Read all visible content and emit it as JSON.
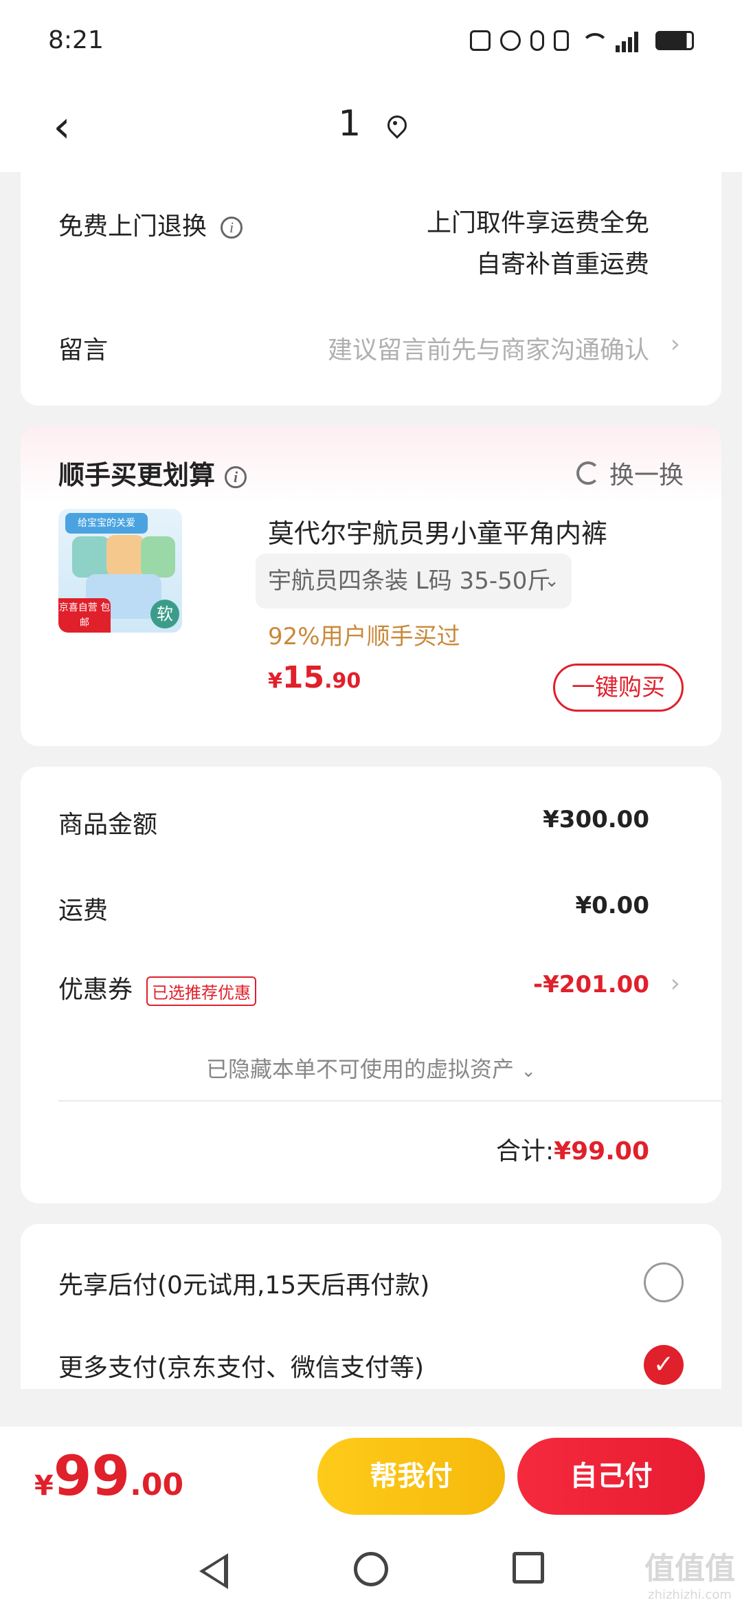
{
  "status_bar": {
    "time": "8:21"
  },
  "nav": {
    "title": "1"
  },
  "returns": {
    "label": "免费上门退换",
    "line1": "上门取件享运费全免",
    "line2": "自寄补首重运费"
  },
  "message": {
    "label": "留言",
    "placeholder": "建议留言前先与商家沟通确认"
  },
  "recommend": {
    "title": "顺手买更划算",
    "swap_label": "换一换",
    "thumb_banner": "给宝宝的关爱",
    "thumb_badge": "京喜自营 包邮",
    "thumb_soft": "软",
    "product_name": "莫代尔宇航员男小童平角内裤",
    "spec": "宇航员四条装   L码 35-50斤",
    "buyers": "92%用户顺手买过",
    "price_yen": "¥",
    "price_int": "15",
    "price_dec": ".90",
    "buy_label": "一键购买"
  },
  "summary": {
    "goods_label": "商品金额",
    "goods_value": "¥300.00",
    "shipping_label": "运费",
    "shipping_value": "¥0.00",
    "coupon_label": "优惠券",
    "coupon_tag": "已选推荐优惠",
    "coupon_value": "-¥201.00",
    "hidden_assets": "已隐藏本单不可使用的虚拟资产",
    "total_label": "合计:",
    "total_value": "¥99.00"
  },
  "payment": {
    "option1": "先享后付(0元试用,15天后再付款)",
    "option2": "更多支付(京东支付、微信支付等)",
    "selected": "option2"
  },
  "bottom": {
    "price_yen": "¥",
    "price_int": "99",
    "price_dec": ".00",
    "help_pay": "帮我付",
    "self_pay": "自己付"
  },
  "watermark": {
    "main": "值值值",
    "sub": "zhizhizhi.com"
  },
  "colors": {
    "accent": "#e0202b",
    "yellow": "#ffcb1a",
    "buyers": "#c9893a"
  }
}
